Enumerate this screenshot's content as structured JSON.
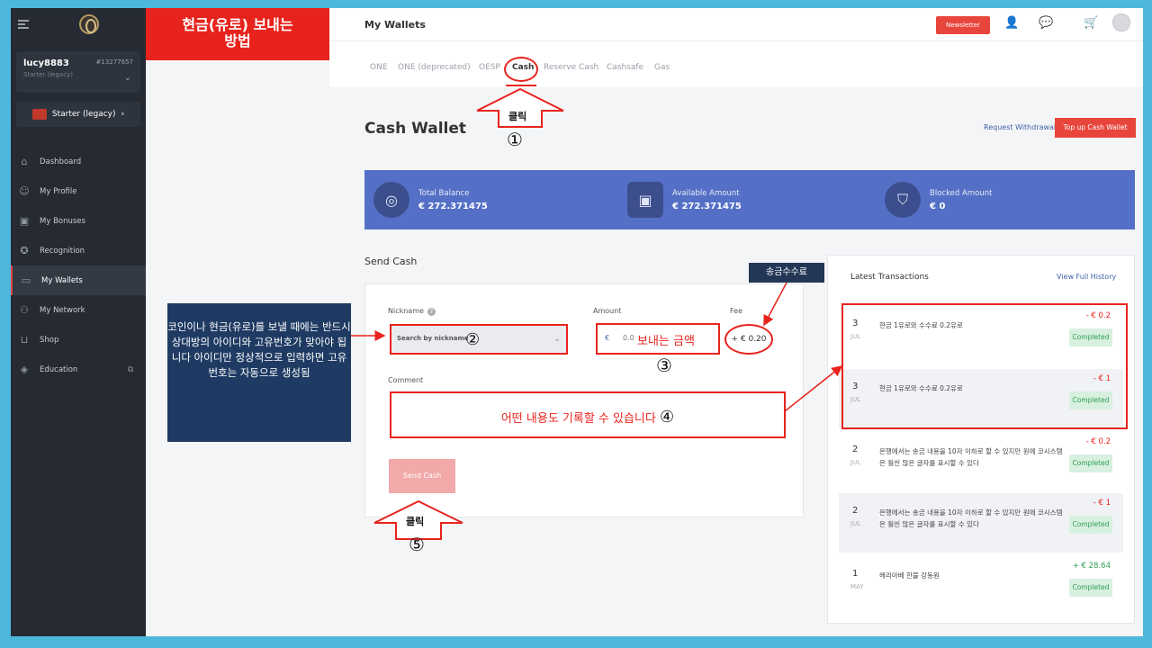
{
  "overlay": {
    "red_label": "현금(유로) 보내는\n방법",
    "click1_label": "클릭",
    "click1_num": "①",
    "nick_num": "②",
    "amount_hint": "보내는 금액",
    "amount_num": "③",
    "comment_hint": "어떤 내용도 기록할 수 있습니다",
    "comment_num": "④",
    "click5_label": "클릭",
    "click5_num": "⑤",
    "fee_tag": "송금수수료",
    "note": "코인이나 현금(유로)를 보낼 때에는 반드시 상대방의 아이디와 고유번호가 맞아야 됩니다 아이디만 정상적으로 입력하면 고유번호는 자동으로 생성됨"
  },
  "sidebar": {
    "user_name": "lucy8883",
    "user_id": "#13277657",
    "user_rank": "Starter (legacy)",
    "rank_button": "Starter (legacy)",
    "items": [
      {
        "label": "Dashboard",
        "icon": "home-icon"
      },
      {
        "label": "My Profile",
        "icon": "user-icon"
      },
      {
        "label": "My Bonuses",
        "icon": "gift-icon"
      },
      {
        "label": "Recognition",
        "icon": "award-icon"
      },
      {
        "label": "My Wallets",
        "icon": "wallet-icon"
      },
      {
        "label": "My Network",
        "icon": "network-icon"
      },
      {
        "label": "Shop",
        "icon": "cart-icon"
      },
      {
        "label": "Education",
        "icon": "education-icon"
      }
    ]
  },
  "header": {
    "title": "My Wallets",
    "newsletter": "Newsletter"
  },
  "tabs": [
    "ONE",
    "ONE (deprecated)",
    "OESP",
    "Cash",
    "Reserve Cash",
    "Cashsafe",
    "Gas"
  ],
  "wallet": {
    "title": "Cash Wallet",
    "request_withdrawal": "Request Withdrawal",
    "top_up": "Top up Cash Wallet",
    "total_label": "Total Balance",
    "total_value": "€ 272.371475",
    "available_label": "Available Amount",
    "available_value": "€ 272.371475",
    "blocked_label": "Blocked Amount",
    "blocked_value": "€ 0"
  },
  "send": {
    "title": "Send Cash",
    "nickname_label": "Nickname",
    "nickname_placeholder": "Search by nickname",
    "amount_label": "Amount",
    "amount_currency": "€",
    "amount_value": "0.0",
    "fee_label": "Fee",
    "fee_value": "+ € 0.20",
    "comment_label": "Comment",
    "send_button": "Send Cash"
  },
  "transactions": {
    "title": "Latest Transactions",
    "view_all": "View Full History",
    "items": [
      {
        "day": "3",
        "month": "JUL",
        "desc": "현금 1유로와 수수료 0.2유로",
        "amount": "- € 0.2",
        "status": "Completed"
      },
      {
        "day": "3",
        "month": "JUL",
        "desc": "현금 1유로와 수수료 0.2유로",
        "amount": "- € 1",
        "status": "Completed"
      },
      {
        "day": "2",
        "month": "JUL",
        "desc": "은행에서는 송금 내용을 10자 이하로 할 수 있지만 원에 코시스템은 훨씬 많은 글자를 표시할 수 있다",
        "amount": "- € 0.2",
        "status": "Completed"
      },
      {
        "day": "2",
        "month": "JUL",
        "desc": "은행에서는 송금 내용을 10자 이하로 할 수 있지만 원에 코시스템은 훨씬 많은 글자를 표시할 수 있다",
        "amount": "- € 1",
        "status": "Completed"
      },
      {
        "day": "1",
        "month": "MAY",
        "desc": "헤리아베 한불 강동원",
        "amount": "+ € 28.64",
        "status": "Completed"
      }
    ]
  }
}
